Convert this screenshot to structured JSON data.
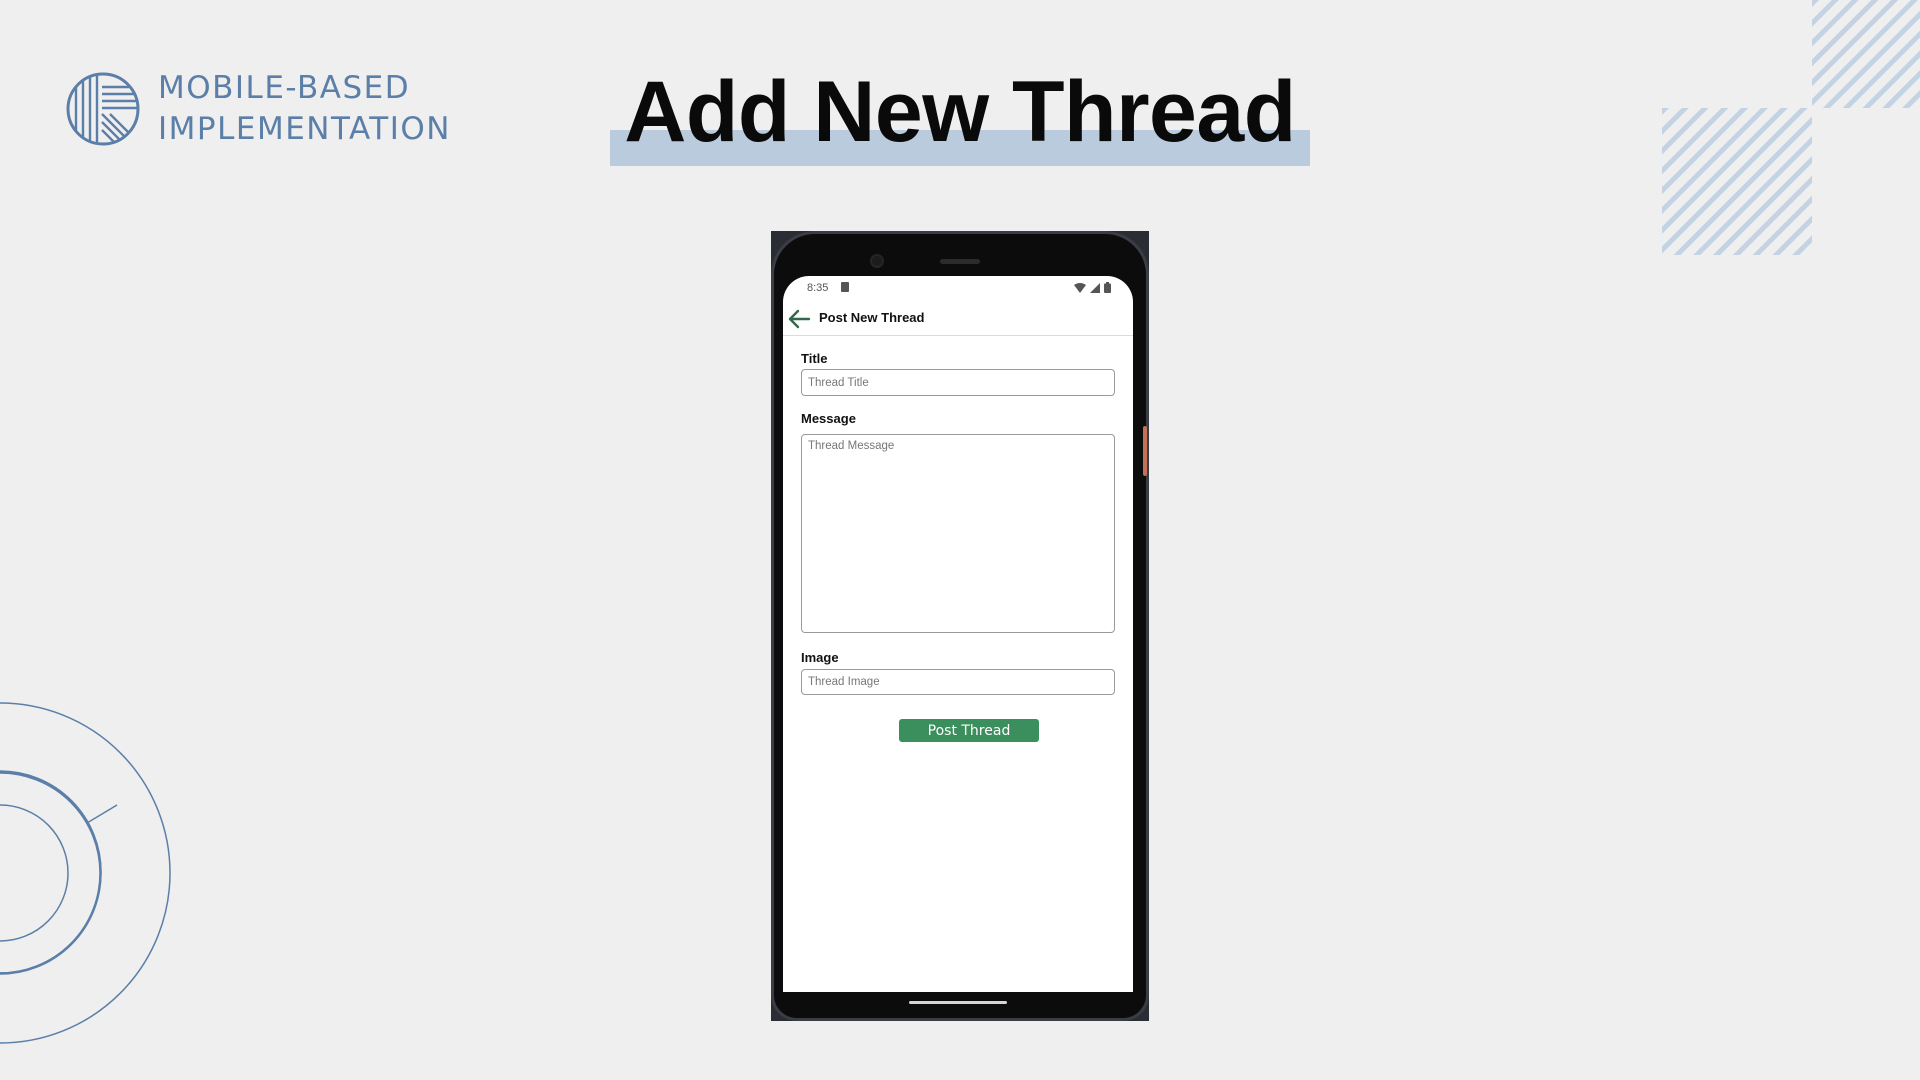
{
  "brand": {
    "line1": "MOBILE-BASED",
    "line2": "IMPLEMENTATION",
    "logo_icon": "striped-circle-logo",
    "color": "#5b7fa8"
  },
  "slide": {
    "title": "Add New Thread",
    "highlight_color": "#b9cbdd"
  },
  "phone": {
    "status_bar": {
      "time": "8:35",
      "icons": [
        "sd-card-icon",
        "wifi-icon",
        "signal-icon",
        "battery-icon"
      ]
    },
    "app_bar": {
      "back_icon": "arrow-left-icon",
      "title": "Post New Thread"
    },
    "form": {
      "title_label": "Title",
      "title_placeholder": "Thread Title",
      "message_label": "Message",
      "message_placeholder": "Thread Message",
      "image_label": "Image",
      "image_placeholder": "Thread Image",
      "submit_label": "Post Thread",
      "submit_color": "#3a8f5d"
    }
  }
}
